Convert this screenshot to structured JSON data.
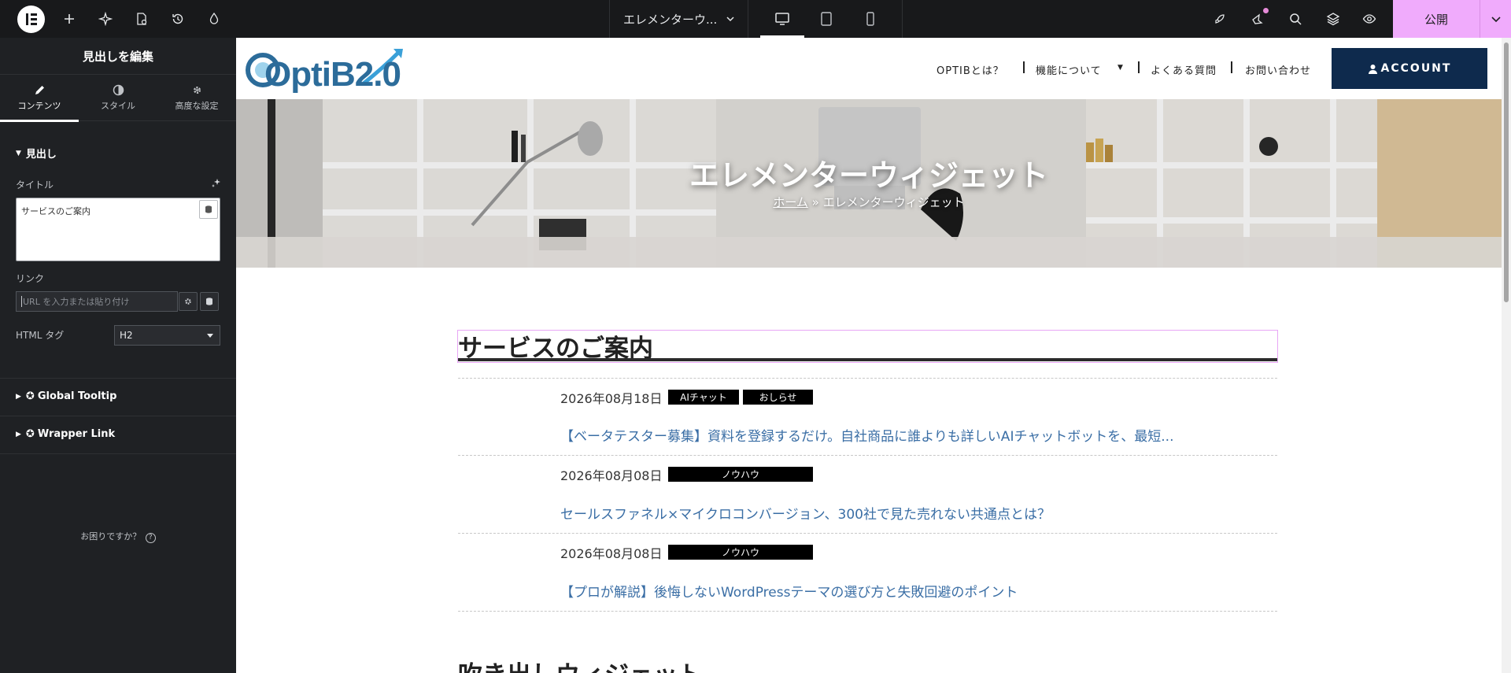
{
  "topbar": {
    "doc_title": "エレメンターウ...",
    "publish_label": "公開"
  },
  "panel": {
    "header": "見出しを編集",
    "tabs": [
      {
        "label": "コンテンツ",
        "icon": "pencil-icon"
      },
      {
        "label": "スタイル",
        "icon": "half-circle-icon"
      },
      {
        "label": "高度な設定",
        "icon": "gear-icon"
      }
    ],
    "section_heading": "見出し",
    "title_label": "タイトル",
    "title_value": "サービスのご案内",
    "link_label": "リンク",
    "link_placeholder": "URL を入力または貼り付け",
    "html_tag_label": "HTML タグ",
    "html_tag_value": "H2",
    "global_tooltip": "Global Tooltip",
    "wrapper_link": "Wrapper Link",
    "help_text": "お困りですか？"
  },
  "site": {
    "logo_text": "OptiB2.0",
    "nav": [
      {
        "label": "OPTIBとは？"
      },
      {
        "label": "機能について"
      },
      {
        "label": "よくある質問"
      },
      {
        "label": "お問い合わせ"
      }
    ],
    "account_label": "ACCOUNT",
    "hero_title": "エレメンターウィジェット",
    "breadcrumb_home": "ホーム",
    "breadcrumb_sep": "»",
    "breadcrumb_current": "エレメンターウィジェット",
    "section_heading": "サービスのご案内",
    "posts": [
      {
        "date": "2026年08月18日",
        "tags": [
          "AIチャット",
          "おしらせ"
        ],
        "title": "【ベータテスター募集】資料を登録するだけ。自社商品に誰よりも詳しいAIチャットボットを、最短..."
      },
      {
        "date": "2026年08月08日",
        "tags": [
          "ノウハウ"
        ],
        "title": "セールスファネル×マイクロコンバージョン、300社で見た売れない共通点とは？"
      },
      {
        "date": "2026年08月08日",
        "tags": [
          "ノウハウ"
        ],
        "title": "【プロが解説】後悔しないWordPressテーマの選び方と失敗回避のポイント"
      }
    ],
    "next_heading": "吹き出しウィジェット"
  },
  "colors": {
    "topbar_bg": "#18191b",
    "panel_bg": "#1f2124",
    "publish_bg": "#f0abfc",
    "account_bg": "#0e2a4d",
    "link_color": "#3a6ea5",
    "selection_border": "#e8a6f5"
  }
}
